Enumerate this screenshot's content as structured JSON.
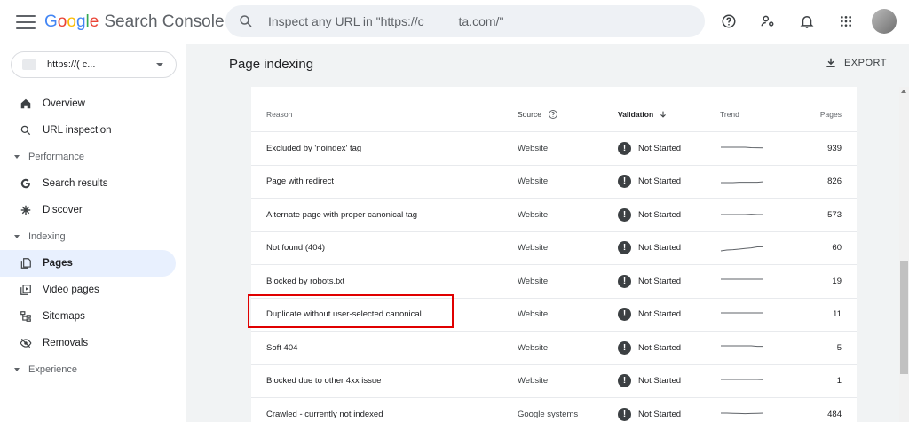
{
  "app": {
    "logo_letters": [
      {
        "ch": "G",
        "color": "#4285F4"
      },
      {
        "ch": "o",
        "color": "#EA4335"
      },
      {
        "ch": "o",
        "color": "#FBBC05"
      },
      {
        "ch": "g",
        "color": "#4285F4"
      },
      {
        "ch": "l",
        "color": "#34A853"
      },
      {
        "ch": "e",
        "color": "#EA4335"
      }
    ],
    "product": "Search Console"
  },
  "search": {
    "placeholder": "Inspect any URL in \"https://c          ta.com/\""
  },
  "top_icons": [
    "help-icon",
    "account-settings-icon",
    "notifications-icon",
    "apps-icon"
  ],
  "property": {
    "label": "https://(          c..."
  },
  "sidebar": {
    "overview": "Overview",
    "url_inspection": "URL inspection",
    "performance": "Performance",
    "search_results": "Search results",
    "discover": "Discover",
    "indexing": "Indexing",
    "pages": "Pages",
    "video_pages": "Video pages",
    "sitemaps": "Sitemaps",
    "removals": "Removals",
    "experience": "Experience"
  },
  "page": {
    "title": "Page indexing",
    "export": "EXPORT"
  },
  "table": {
    "headers": {
      "reason": "Reason",
      "source": "Source",
      "validation": "Validation",
      "trend": "Trend",
      "pages": "Pages"
    },
    "warn_glyph": "!",
    "rows": [
      {
        "reason": "Excluded by 'noindex' tag",
        "source": "Website",
        "validation": "Not Started",
        "trend": [
          3,
          3,
          3,
          3,
          3,
          3.5,
          3.6,
          3.8
        ],
        "pages": "939"
      },
      {
        "reason": "Page with redirect",
        "source": "Website",
        "validation": "Not Started",
        "trend": [
          5,
          5,
          5,
          4.6,
          4.6,
          4.6,
          4.6,
          4
        ],
        "pages": "826"
      },
      {
        "reason": "Alternate page with proper canonical tag",
        "source": "Website",
        "validation": "Not Started",
        "trend": [
          4,
          4,
          4,
          4,
          4,
          3.6,
          4,
          4
        ],
        "pages": "573"
      },
      {
        "reason": "Not found (404)",
        "source": "Website",
        "validation": "Not Started",
        "trend": [
          7,
          6,
          5.6,
          5,
          4.2,
          3.6,
          2.5,
          2.4
        ],
        "pages": "60"
      },
      {
        "reason": "Blocked by robots.txt",
        "source": "Website",
        "validation": "Not Started",
        "trend": [
          2,
          2,
          2,
          2,
          2,
          2,
          2,
          2
        ],
        "pages": "19"
      },
      {
        "reason": "Duplicate without user-selected canonical",
        "source": "Website",
        "validation": "Not Started",
        "trend": [
          2,
          2,
          2,
          2,
          2,
          2,
          2,
          2
        ],
        "pages": "11"
      },
      {
        "reason": "Soft 404",
        "source": "Website",
        "validation": "Not Started",
        "trend": [
          2,
          2,
          2,
          2,
          2,
          2,
          2.6,
          2.6
        ],
        "pages": "5"
      },
      {
        "reason": "Blocked due to other 4xx issue",
        "source": "Website",
        "validation": "Not Started",
        "trend": [
          2,
          2,
          2,
          2,
          2,
          2,
          2,
          2.3
        ],
        "pages": "1"
      },
      {
        "reason": "Crawled - currently not indexed",
        "source": "Google systems",
        "validation": "Not Started",
        "trend": [
          3,
          3,
          3.2,
          3.4,
          3.6,
          3.4,
          3.2,
          3
        ],
        "pages": "484"
      }
    ]
  },
  "highlight_color": "#e00000"
}
